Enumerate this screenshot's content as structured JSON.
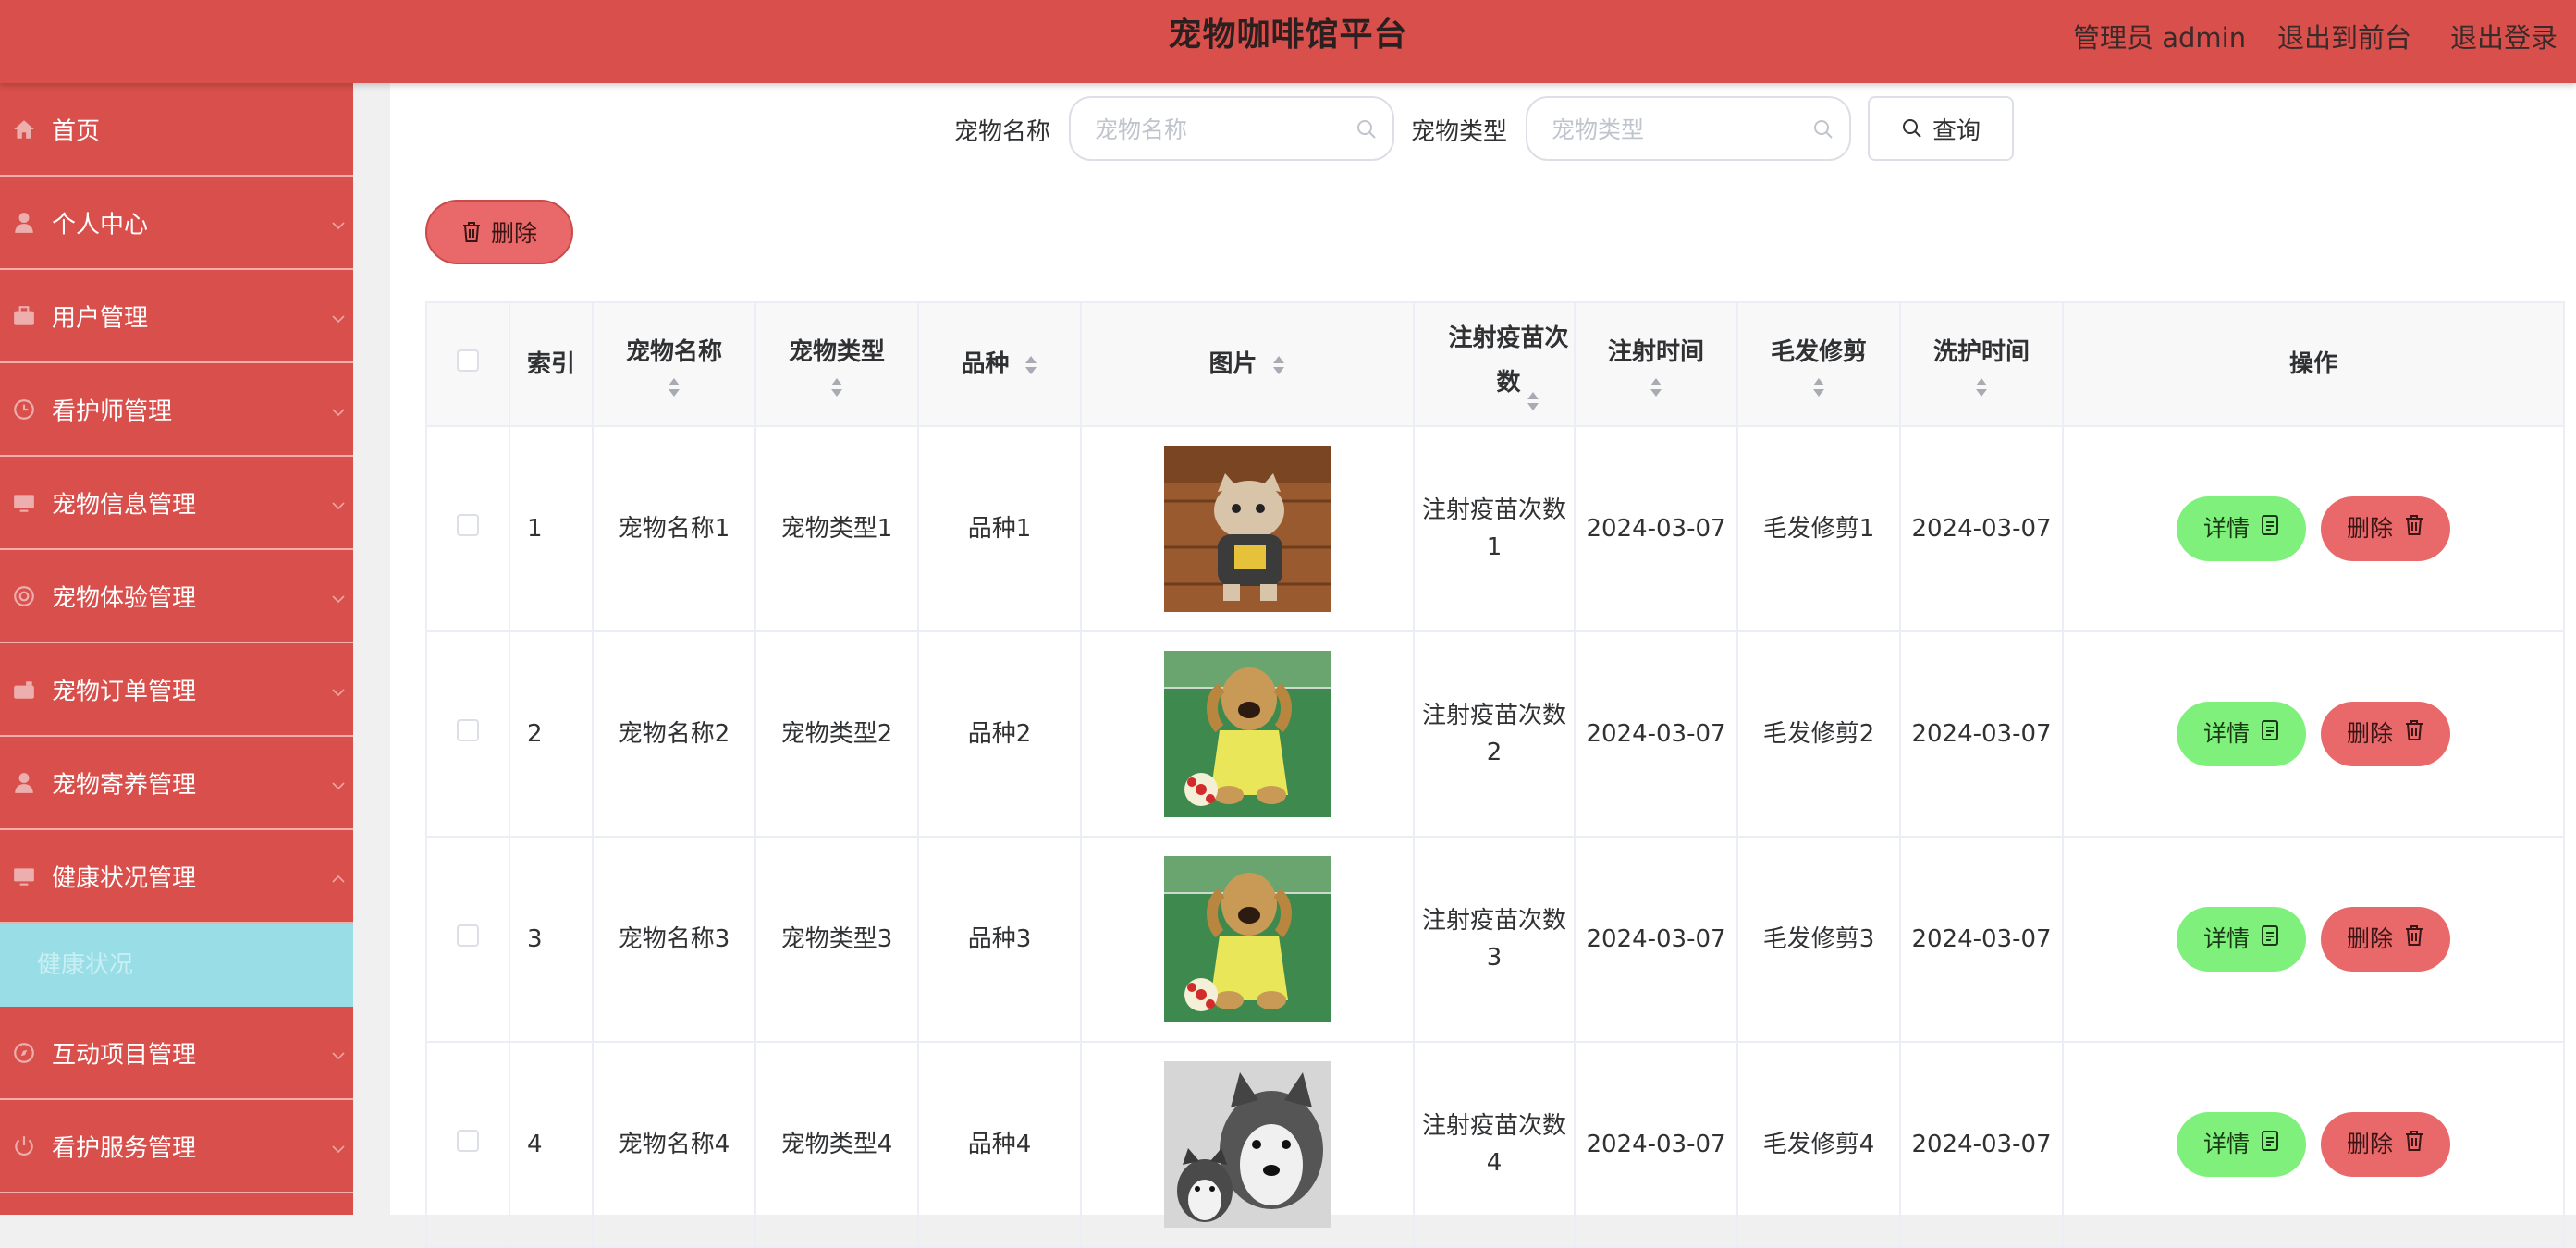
{
  "header": {
    "title": "宠物咖啡馆平台",
    "user_label": "管理员 admin",
    "to_front": "退出到前台",
    "logout": "退出登录"
  },
  "sidebar": {
    "items": [
      {
        "label": "首页",
        "icon": "home-icon"
      },
      {
        "label": "个人中心",
        "icon": "user-icon"
      },
      {
        "label": "用户管理",
        "icon": "briefcase-icon"
      },
      {
        "label": "看护师管理",
        "icon": "clock-icon"
      },
      {
        "label": "宠物信息管理",
        "icon": "monitor-icon"
      },
      {
        "label": "宠物体验管理",
        "icon": "target-icon"
      },
      {
        "label": "宠物订单管理",
        "icon": "camera-icon"
      },
      {
        "label": "宠物寄养管理",
        "icon": "person-icon"
      },
      {
        "label": "健康状况管理",
        "icon": "monitor-icon"
      },
      {
        "label": "互动项目管理",
        "icon": "compass-icon"
      },
      {
        "label": "看护服务管理",
        "icon": "power-icon"
      }
    ],
    "active_sub": "健康状况"
  },
  "search": {
    "name_label": "宠物名称",
    "name_placeholder": "宠物名称",
    "type_label": "宠物类型",
    "type_placeholder": "宠物类型",
    "query_button": "查询"
  },
  "toolbar": {
    "delete_button": "删除"
  },
  "table": {
    "headers": {
      "index": "索引",
      "name": "宠物名称",
      "type": "宠物类型",
      "breed": "品种",
      "image": "图片",
      "vaccine": "注射疫苗次数",
      "vaccine_time": "注射时间",
      "grooming": "毛发修剪",
      "wash_time": "洗护时间",
      "actions": "操作"
    },
    "rows": [
      {
        "index": "1",
        "name": "宠物名称1",
        "type": "宠物类型1",
        "breed": "品种1",
        "image": "cat-in-costume",
        "vaccine": "注射疫苗次数1",
        "vaccine_time": "2024-03-07",
        "grooming": "毛发修剪1",
        "wash_time": "2024-03-07"
      },
      {
        "index": "2",
        "name": "宠物名称2",
        "type": "宠物类型2",
        "breed": "品种2",
        "image": "dog-with-ball",
        "vaccine": "注射疫苗次数2",
        "vaccine_time": "2024-03-07",
        "grooming": "毛发修剪2",
        "wash_time": "2024-03-07"
      },
      {
        "index": "3",
        "name": "宠物名称3",
        "type": "宠物类型3",
        "breed": "品种3",
        "image": "dog-with-ball",
        "vaccine": "注射疫苗次数3",
        "vaccine_time": "2024-03-07",
        "grooming": "毛发修剪3",
        "wash_time": "2024-03-07"
      },
      {
        "index": "4",
        "name": "宠物名称4",
        "type": "宠物类型4",
        "breed": "品种4",
        "image": "husky-pair",
        "vaccine": "注射疫苗次数4",
        "vaccine_time": "2024-03-07",
        "grooming": "毛发修剪4",
        "wash_time": "2024-03-07"
      }
    ],
    "detail_label": "详情",
    "delete_label": "删除"
  },
  "colors": {
    "primary": "#d94f4b",
    "submenu_active": "#99dde6",
    "detail_button": "#7ff07c",
    "delete_button": "#e9686a"
  }
}
